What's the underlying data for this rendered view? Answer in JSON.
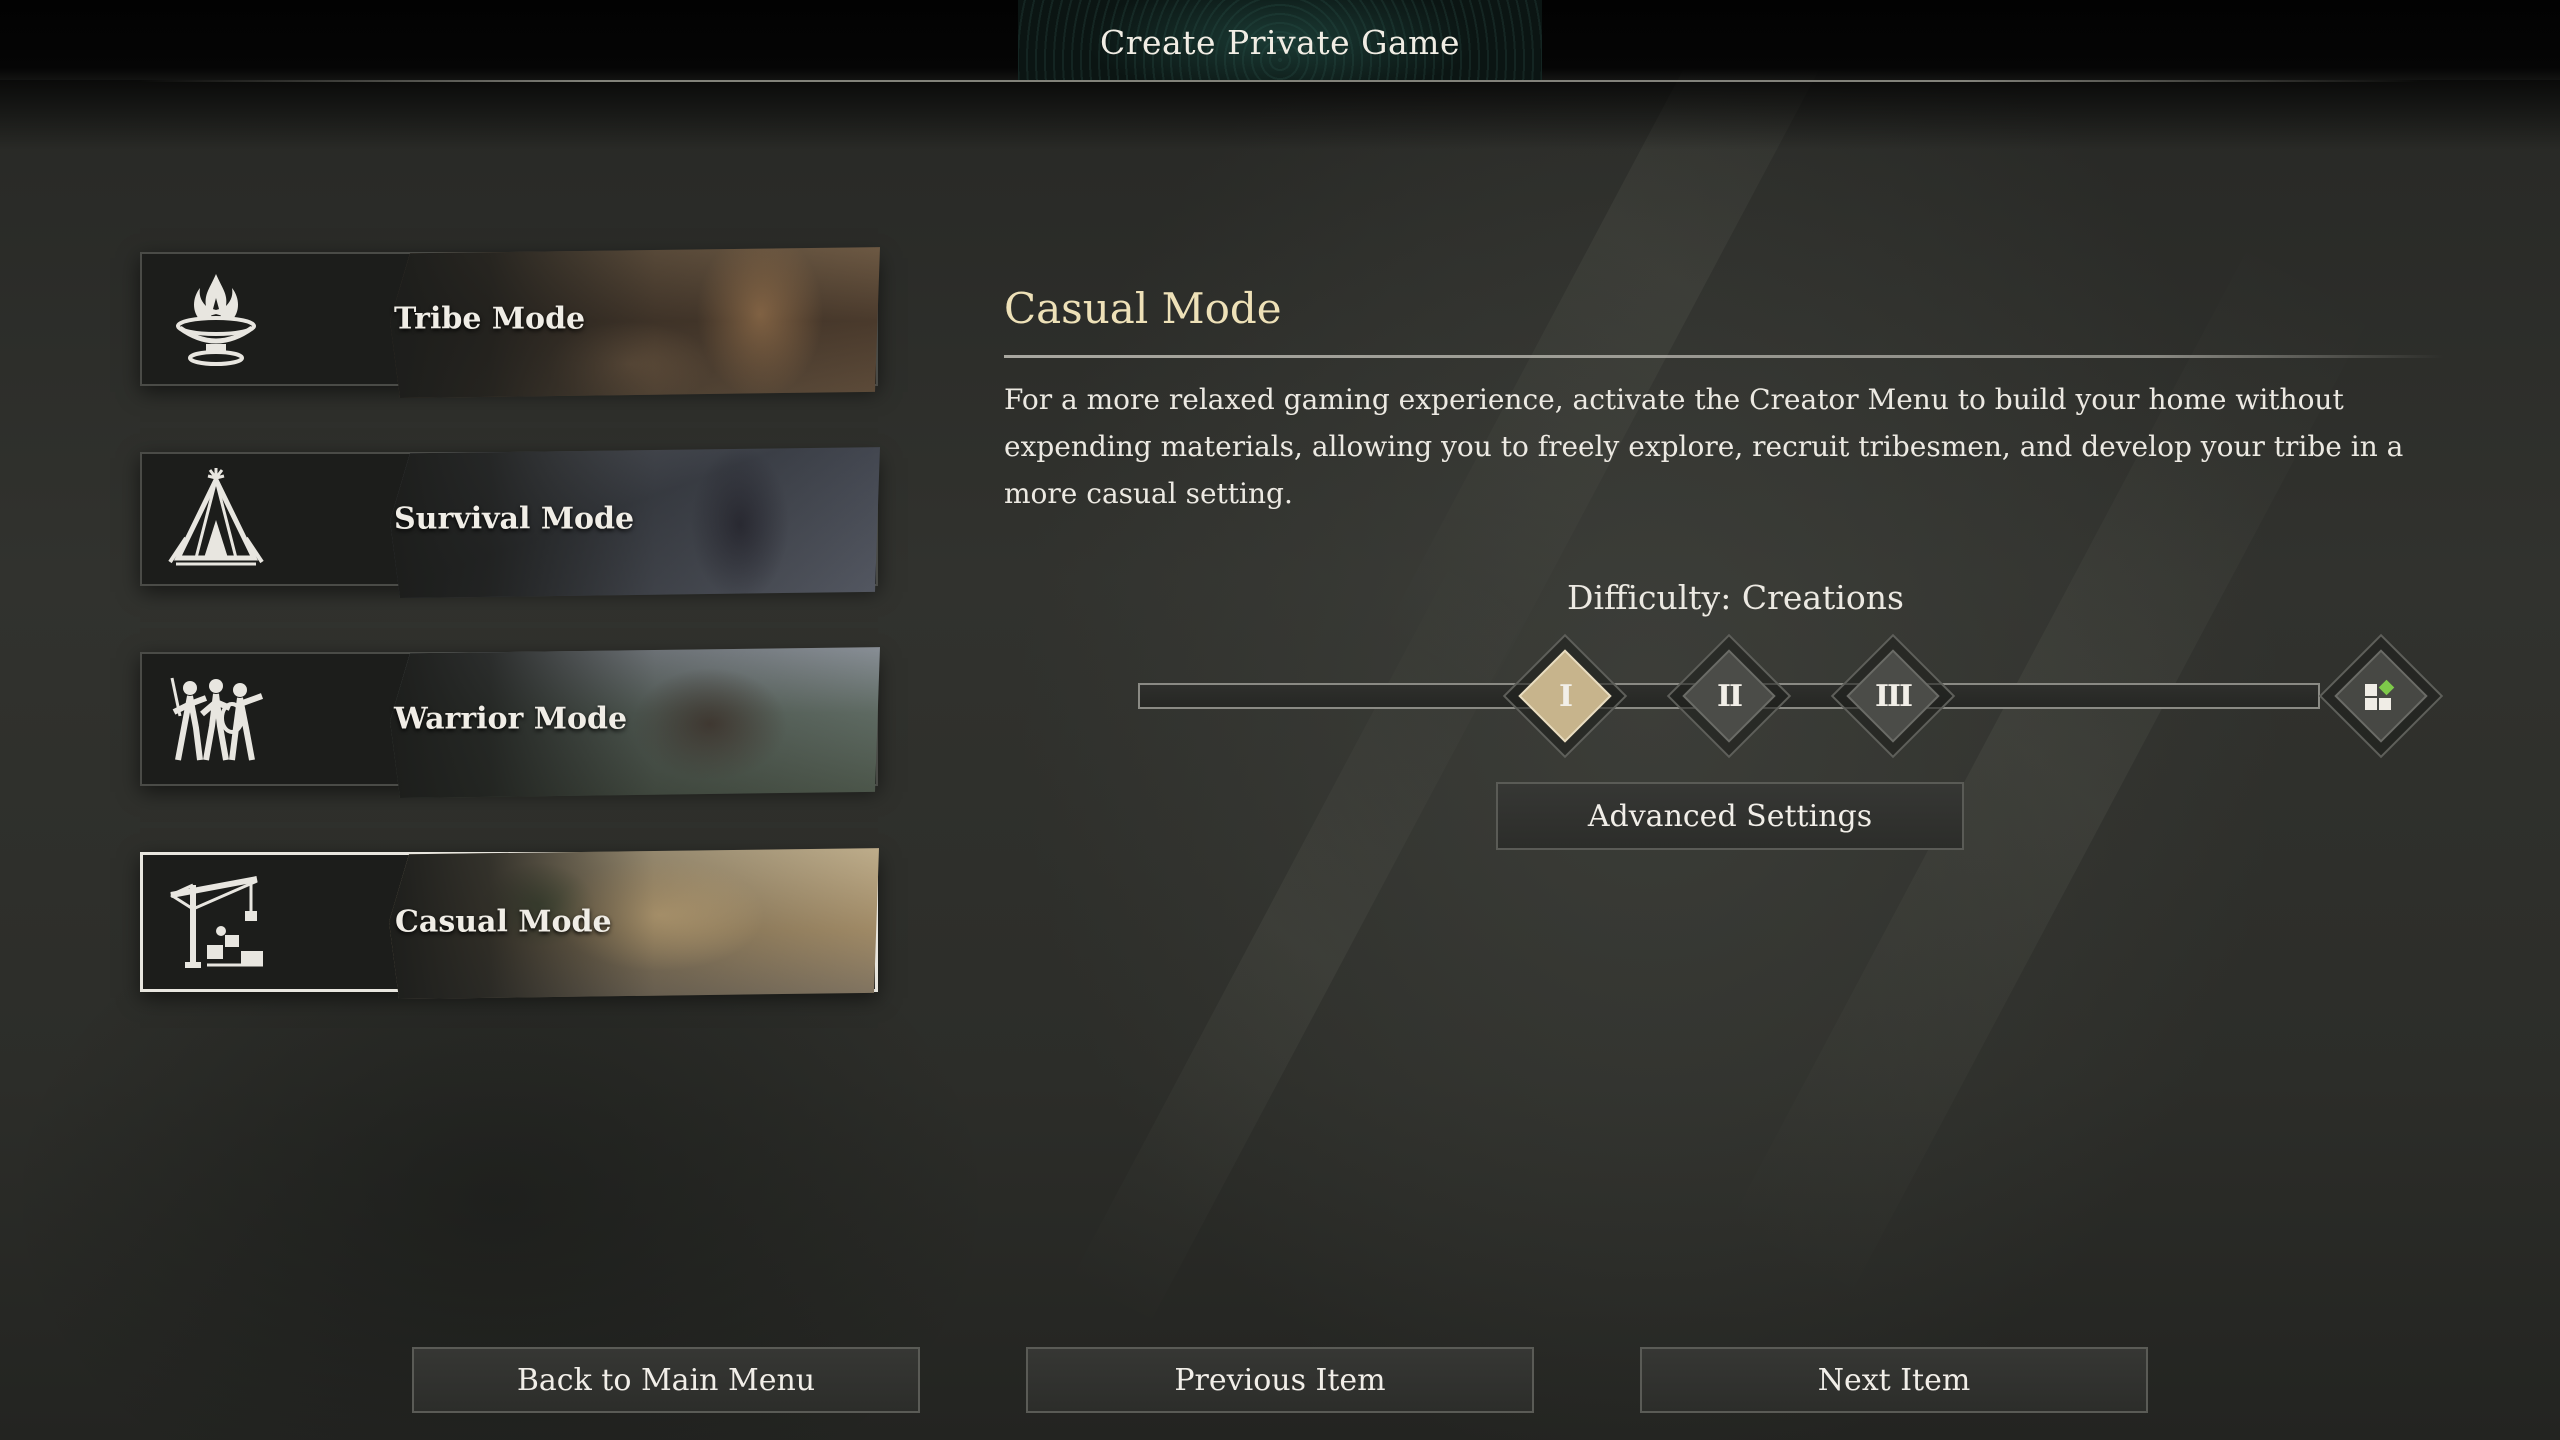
{
  "header": {
    "title": "Create Private Game"
  },
  "modes": [
    {
      "label": "Tribe Mode",
      "icon": "campfire-brazier-icon",
      "selected": false
    },
    {
      "label": "Survival Mode",
      "icon": "tent-icon",
      "selected": false
    },
    {
      "label": "Warrior Mode",
      "icon": "warriors-icon",
      "selected": false
    },
    {
      "label": "Casual Mode",
      "icon": "crane-builder-icon",
      "selected": true
    }
  ],
  "detail": {
    "title": "Casual Mode",
    "description": "For a more relaxed gaming experience, activate the Creator Menu to build your home without expending materials, allowing you to freely explore, recruit tribesmen, and develop your tribe in a more casual setting."
  },
  "difficulty": {
    "label": "Difficulty: Creations",
    "levels": [
      "I",
      "II",
      "III"
    ],
    "selected_level": "I",
    "custom_icon": "custom-grid-icon"
  },
  "buttons": {
    "advanced_settings": "Advanced Settings",
    "back": "Back to Main Menu",
    "previous": "Previous Item",
    "next": "Next Item"
  },
  "colors": {
    "accent_title": "#eee1b8",
    "active_diamond": "#c7b48c",
    "custom_icon_green": "#7ec94a"
  }
}
